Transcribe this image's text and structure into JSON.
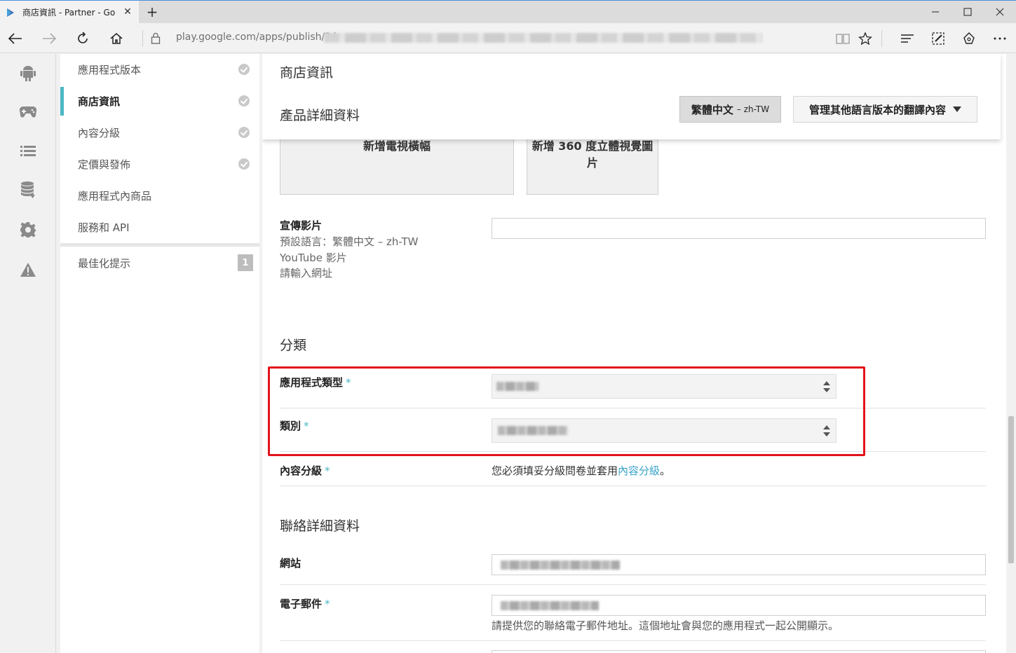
{
  "browser": {
    "tab_title": "商店資訊 - Partner - Go",
    "url": "play.google.com/apps/publish/?de",
    "new_tab": "+"
  },
  "sidebar_menu": [
    {
      "label": "應用程式版本",
      "checked": true
    },
    {
      "label": "商店資訊",
      "checked": true,
      "active": true
    },
    {
      "label": "內容分級",
      "checked": true
    },
    {
      "label": "定價與發佈",
      "checked": true
    },
    {
      "label": "應用程式內商品",
      "checked": false
    },
    {
      "label": "服務和 API",
      "checked": false
    }
  ],
  "optimization": {
    "label": "最佳化提示",
    "badge": "1"
  },
  "header": {
    "store_title": "商店資訊",
    "product_title": "產品詳細資料",
    "language_button": "繁體中文",
    "language_code": "– zh-TW",
    "manage_translations": "管理其他語言版本的翻譯內容"
  },
  "tiles": {
    "tv_banner": "新增電視橫幅",
    "vr_image": "新增 360 度立體視覺圖片"
  },
  "promo_video": {
    "label": "宣傳影片",
    "default_language": "預設語言：繁體中文 – zh-TW",
    "youtube": "YouTube 影片",
    "hint": "請輸入網址"
  },
  "categorization": {
    "title": "分類",
    "app_type_label": "應用程式類型",
    "category_label": "類別",
    "required_mark": "*"
  },
  "content_rating": {
    "label": "內容分級",
    "text_before": "您必須填妥分級問卷並套用",
    "link": "內容分級",
    "text_after": "。"
  },
  "contact": {
    "title": "聯絡詳細資料",
    "website_label": "網站",
    "email_label": "電子郵件",
    "email_help": "請提供您的聯絡電子郵件地址。這個地址會與您的應用程式一起公開顯示。"
  },
  "icons": {
    "rail": [
      "android-icon",
      "gamepad-icon",
      "list-icon",
      "database-icon",
      "gear-icon",
      "warning-icon"
    ]
  },
  "colors": {
    "accent": "#4cb8c4",
    "highlight": "#e3131b"
  }
}
